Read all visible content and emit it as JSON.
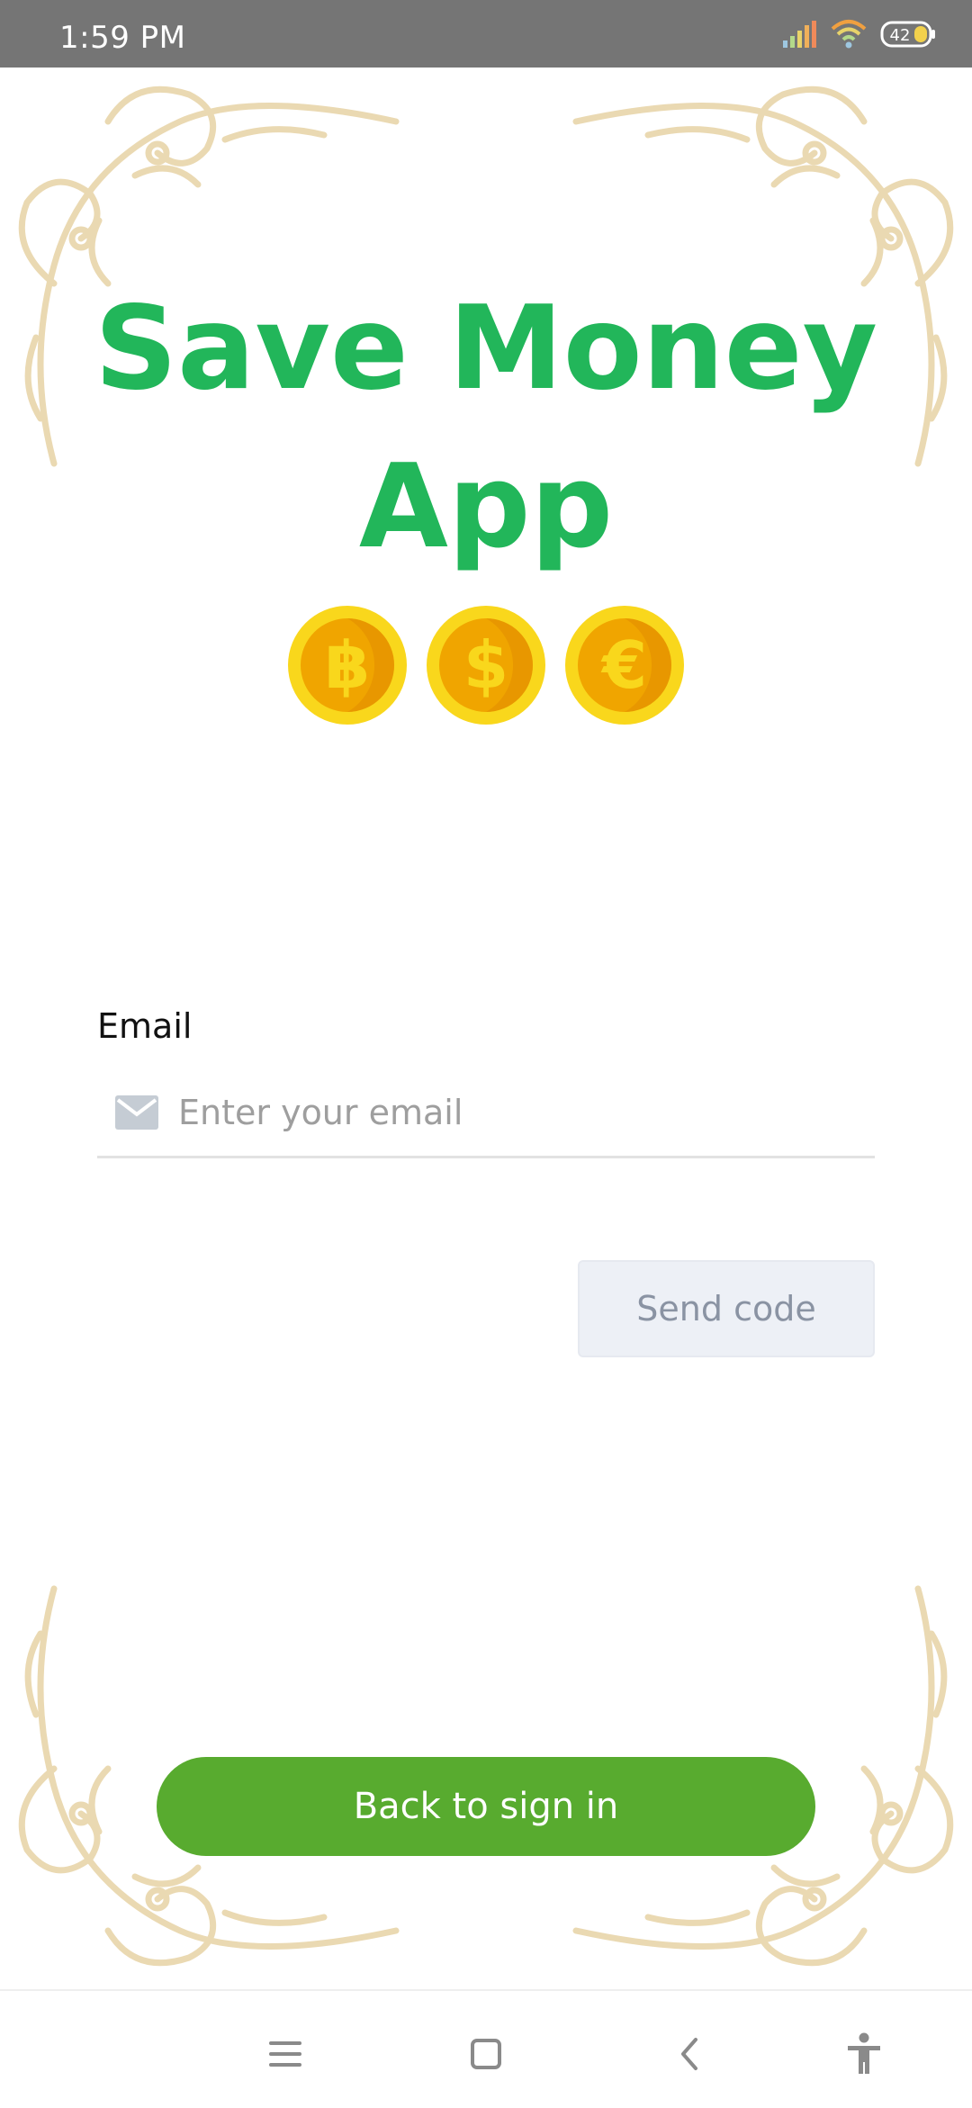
{
  "status_bar": {
    "time": "1:59 PM",
    "battery_level": "42",
    "icons": [
      "signal-icon",
      "wifi-icon",
      "battery-icon"
    ]
  },
  "header": {
    "title_line1": "Save Money",
    "title_line2": "App",
    "coin_icons": [
      "bitcoin-coin-icon",
      "dollar-coin-icon",
      "euro-coin-icon"
    ]
  },
  "form": {
    "email_label": "Email",
    "email_placeholder": "Enter your email",
    "email_value": "",
    "send_code_label": "Send code",
    "back_label": "Back to sign in"
  },
  "nav_bar": {
    "icons": [
      "menu-icon",
      "home-icon",
      "back-icon",
      "accessibility-icon"
    ]
  },
  "colors": {
    "title_green": "#22b65a",
    "button_green": "#58ab2f",
    "status_bar": "#757575",
    "ornament": "#ead9b2",
    "coin_gold": "#f9d71c",
    "coin_orange": "#f0a500"
  }
}
